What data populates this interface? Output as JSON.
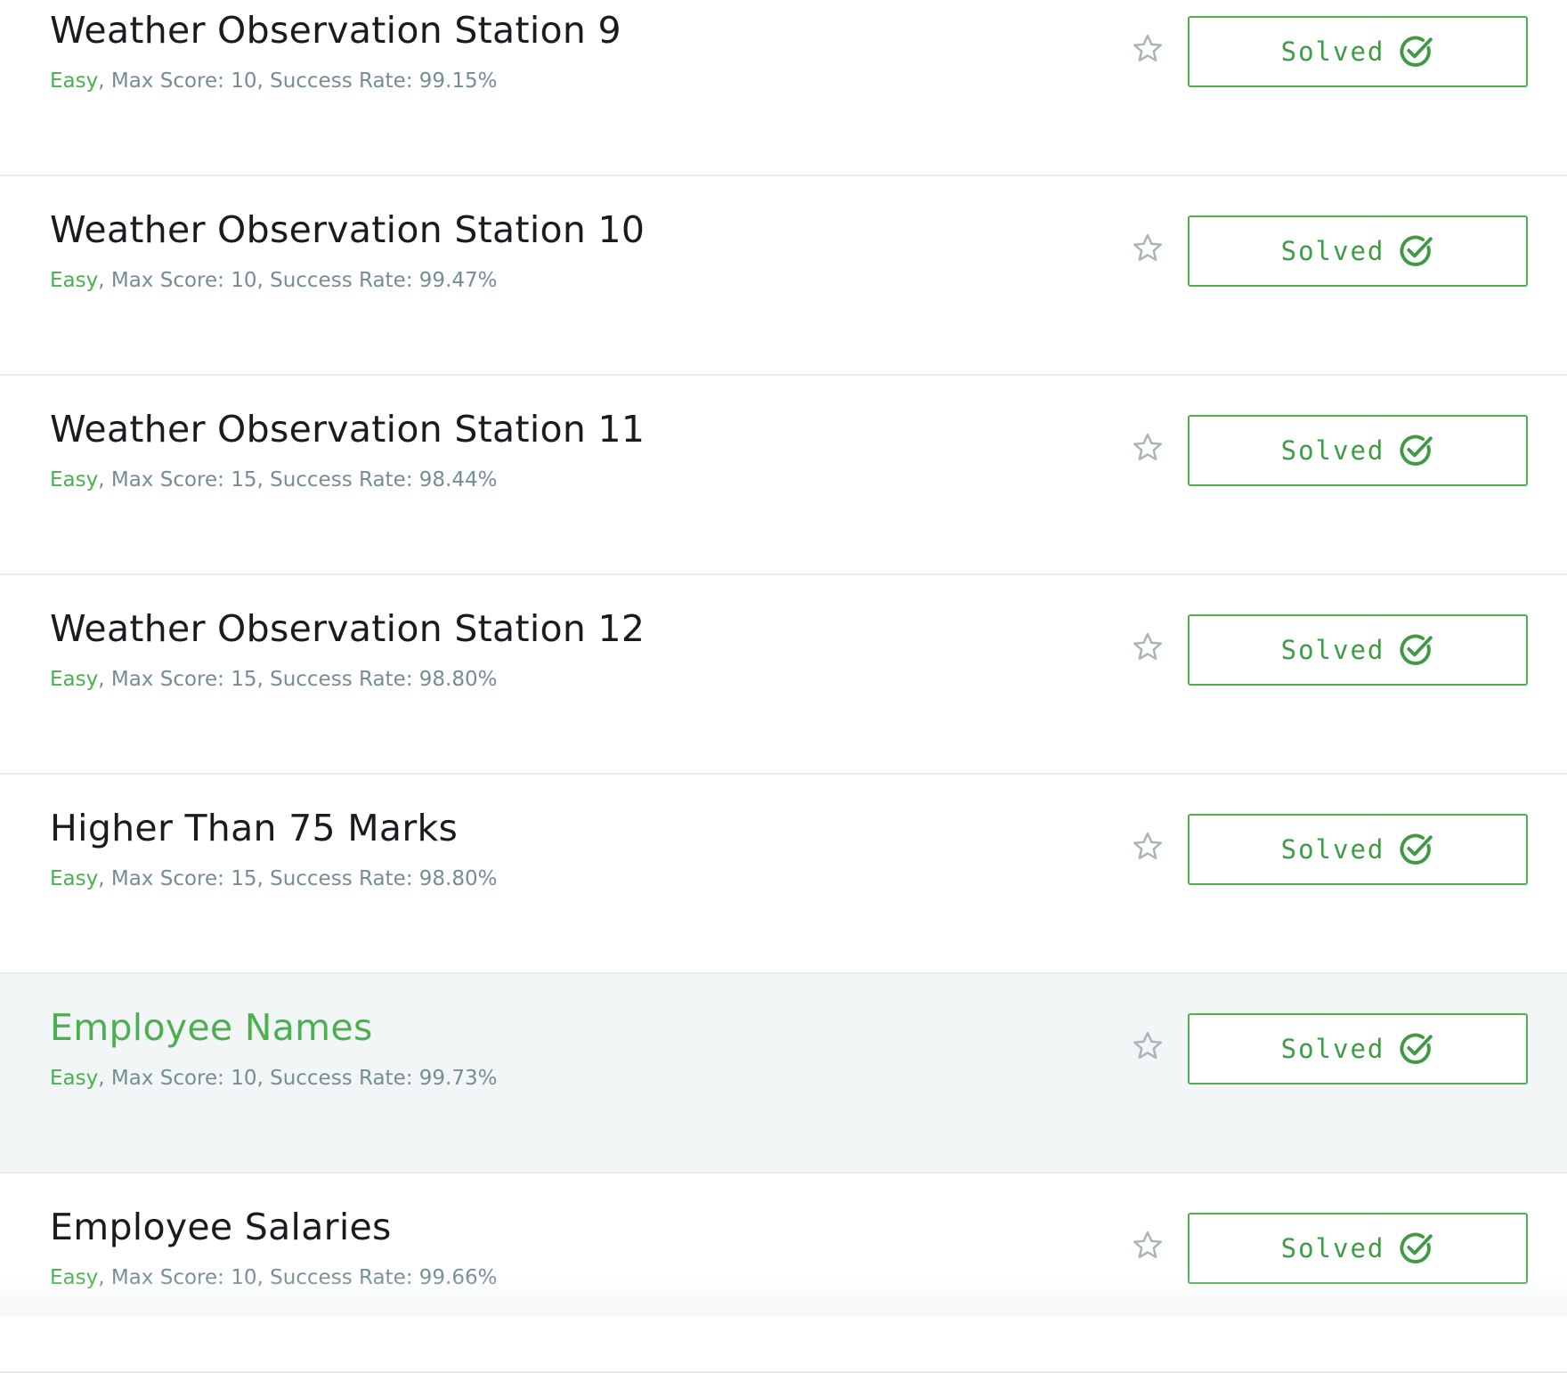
{
  "challenges": [
    {
      "title": "Weather Observation Station 9",
      "difficulty": "Easy",
      "max_score": "10",
      "success_rate": "99.15%",
      "status": "Solved",
      "highlighted": false
    },
    {
      "title": "Weather Observation Station 10",
      "difficulty": "Easy",
      "max_score": "10",
      "success_rate": "99.47%",
      "status": "Solved",
      "highlighted": false
    },
    {
      "title": "Weather Observation Station 11",
      "difficulty": "Easy",
      "max_score": "15",
      "success_rate": "98.44%",
      "status": "Solved",
      "highlighted": false
    },
    {
      "title": "Weather Observation Station 12",
      "difficulty": "Easy",
      "max_score": "15",
      "success_rate": "98.80%",
      "status": "Solved",
      "highlighted": false
    },
    {
      "title": "Higher Than 75 Marks",
      "difficulty": "Easy",
      "max_score": "15",
      "success_rate": "98.80%",
      "status": "Solved",
      "highlighted": false
    },
    {
      "title": "Employee Names",
      "difficulty": "Easy",
      "max_score": "10",
      "success_rate": "99.73%",
      "status": "Solved",
      "highlighted": true
    },
    {
      "title": "Employee Salaries",
      "difficulty": "Easy",
      "max_score": "10",
      "success_rate": "99.66%",
      "status": "Solved",
      "highlighted": false
    }
  ],
  "labels": {
    "max_score_prefix": "Max Score: ",
    "success_rate_prefix": "Success Rate: ",
    "separator": ", "
  },
  "icons": {
    "bookmark": "star-outline-icon",
    "solved": "check-circle-icon"
  },
  "colors": {
    "accent_green": "#4caf50",
    "title_text": "#1a1b20",
    "meta_text": "#738f93",
    "star_outline": "#a8b6ba",
    "row_highlight": "#f3f6f7",
    "divider": "#e7ebee"
  }
}
